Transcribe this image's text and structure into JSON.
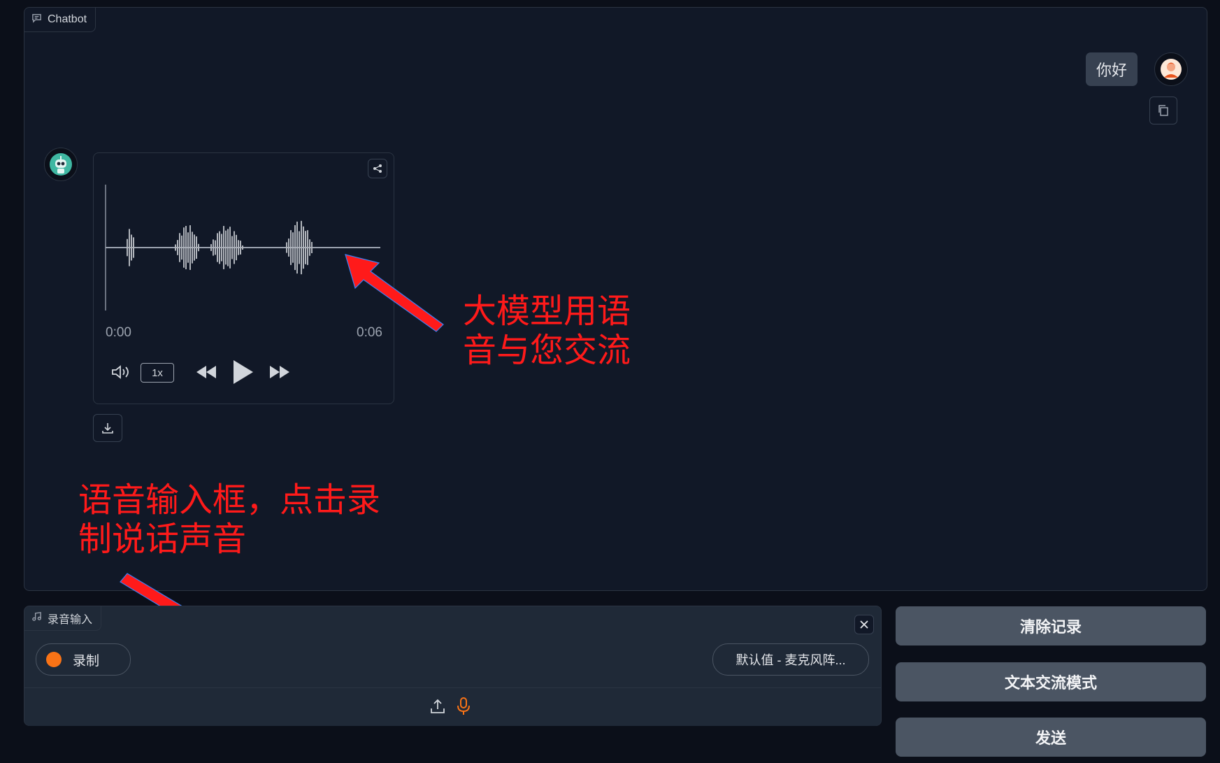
{
  "chatbot": {
    "label": "Chatbot",
    "label_icon": "chat-icon",
    "user_message": "你好",
    "copy_icon": "copy-icon",
    "bot_message": {
      "type": "audio",
      "current_time": "0:00",
      "duration": "0:06",
      "playback_rate": "1x",
      "icons": [
        "share-icon",
        "volume-icon",
        "rewind-icon",
        "play-icon",
        "fast-forward-icon",
        "download-icon"
      ]
    }
  },
  "annotations": {
    "audio_note": "大模型用语\n音与您交流",
    "input_note": "语音输入框，点击录\n制说话声音",
    "color": "#ff1a1a"
  },
  "recorder": {
    "label": "录音输入",
    "label_icon": "music-icon",
    "record_label": "录制",
    "device_label": "默认值 - 麦克风阵...",
    "icons": [
      "close-icon",
      "upload-icon",
      "microphone-icon"
    ],
    "record_color": "#f97316"
  },
  "sidebar_buttons": {
    "clear": "清除记录",
    "text_mode": "文本交流模式",
    "send": "发送"
  },
  "colors": {
    "background": "#0b0f19",
    "panel": "#111827",
    "button": "#4b5563",
    "accent": "#f97316"
  }
}
